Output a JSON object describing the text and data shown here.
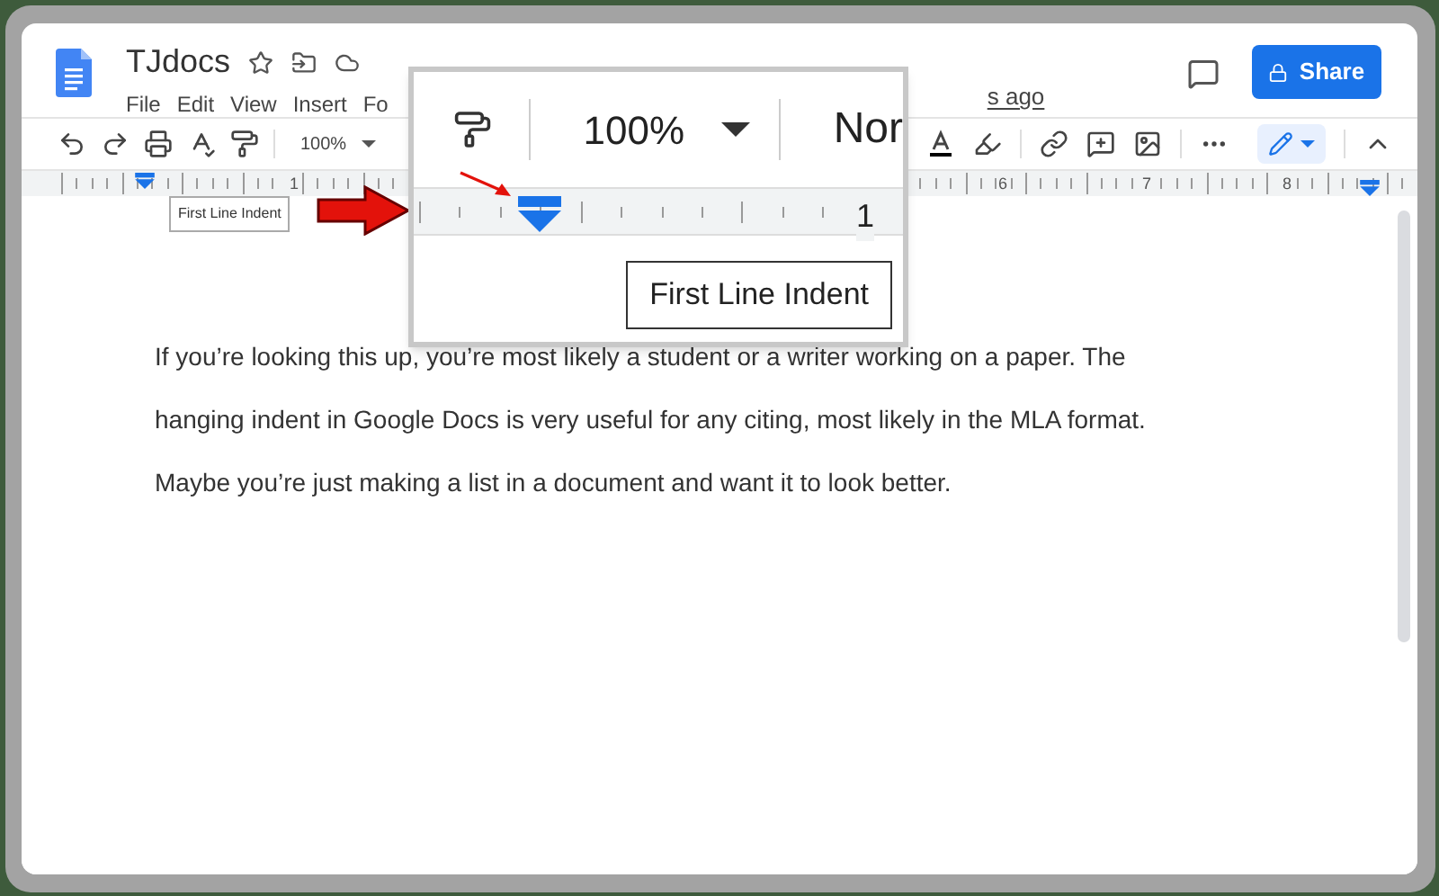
{
  "document": {
    "title": "TJdocs",
    "menus": [
      "File",
      "Edit",
      "View",
      "Insert",
      "Fo"
    ],
    "last_edit": "s ago",
    "share_label": "Share"
  },
  "toolbar": {
    "zoom": "100%"
  },
  "ruler": {
    "labels": [
      "1",
      "6",
      "7",
      "8"
    ]
  },
  "indent_tooltip": "First Line Indent",
  "magnifier": {
    "zoom": "100%",
    "style": "Nor",
    "ruler_label": "1",
    "tooltip": "First Line Indent"
  },
  "paragraph_lines": [
    "If you’re looking this up, you’re most likely a student or a writer working on a paper. The",
    "hanging indent in Google Docs is very useful for any citing, most likely in the MLA format.",
    "Maybe you’re just making a list in a document and want it to look better."
  ]
}
